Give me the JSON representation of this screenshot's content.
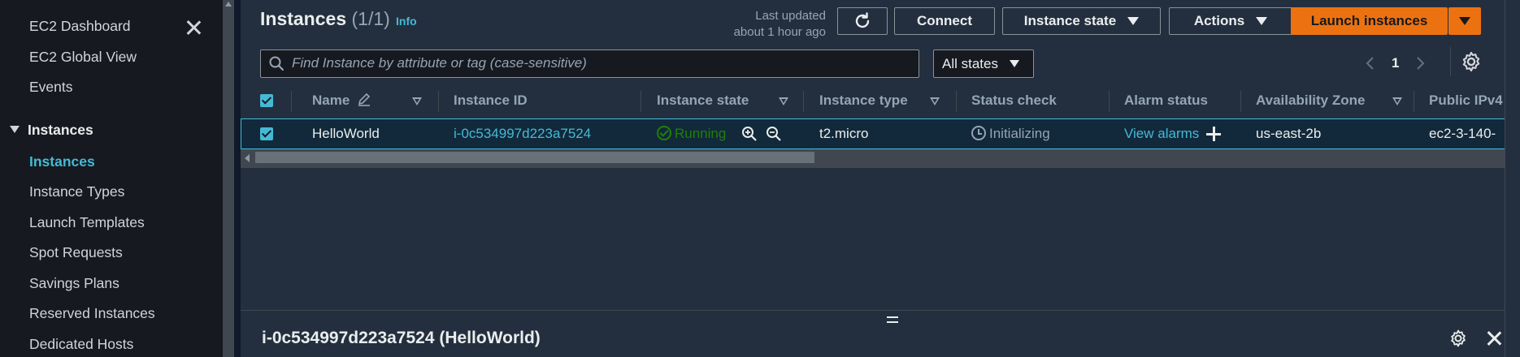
{
  "sidebar": {
    "items_top": [
      {
        "label": "EC2 Dashboard"
      },
      {
        "label": "EC2 Global View"
      },
      {
        "label": "Events"
      }
    ],
    "section_label": "Instances",
    "section_items": [
      {
        "label": "Instances",
        "active": true
      },
      {
        "label": "Instance Types"
      },
      {
        "label": "Launch Templates"
      },
      {
        "label": "Spot Requests"
      },
      {
        "label": "Savings Plans"
      },
      {
        "label": "Reserved Instances"
      },
      {
        "label": "Dedicated Hosts"
      }
    ]
  },
  "header": {
    "title": "Instances",
    "count": "(1/1)",
    "info_label": "Info",
    "last_updated_label": "Last updated",
    "last_updated_value": "about 1 hour ago",
    "connect_label": "Connect",
    "instance_state_label": "Instance state",
    "actions_label": "Actions",
    "launch_label": "Launch instances"
  },
  "filter": {
    "search_placeholder": "Find Instance by attribute or tag (case-sensitive)",
    "search_value": "",
    "state_select": "All states"
  },
  "pagination": {
    "page": "1"
  },
  "table": {
    "columns": [
      "Name",
      "Instance ID",
      "Instance state",
      "Instance type",
      "Status check",
      "Alarm status",
      "Availability Zone",
      "Public IPv4"
    ],
    "rows": [
      {
        "name": "HelloWorld",
        "instance_id": "i-0c534997d223a7524",
        "state": "Running",
        "type": "t2.micro",
        "status_check": "Initializing",
        "alarm_status": "View alarms",
        "az": "us-east-2b",
        "public_ipv4": "ec2-3-140-"
      }
    ]
  },
  "split_panel": {
    "title": "i-0c534997d223a7524 (HelloWorld)"
  },
  "colors": {
    "accent": "#44b9d6",
    "launch": "#ec7211",
    "running": "#1d8102",
    "bg": "#232f3e",
    "sidebar_bg": "#16191f"
  }
}
